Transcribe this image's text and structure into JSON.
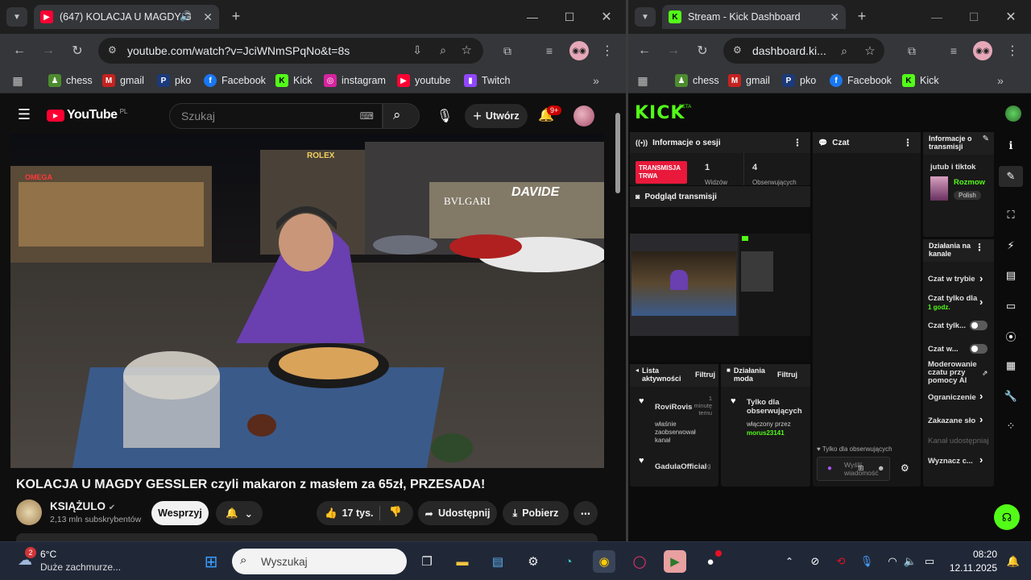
{
  "left_window": {
    "tab_title": "(647) KOLACJA U MAGDY G",
    "url": "youtube.com/watch?v=JciWNmSPqNo&t=8s",
    "bookmarks": [
      "chess",
      "gmail",
      "pko",
      "Facebook",
      "Kick",
      "instagram",
      "youtube",
      "Twitch"
    ]
  },
  "youtube": {
    "logo": "YouTube",
    "country": "PL",
    "search_placeholder": "Szukaj",
    "create_label": "Utwórz",
    "notif_count": "9+",
    "video_title": "KOLACJA U MAGDY GESSLER czyli makaron z masłem za 65zł, PRZESADA!",
    "channel_name": "KSIĄŻULO",
    "subscribers": "2,13 mln subskrybentów",
    "support_label": "Wesprzyj",
    "likes": "17 tys.",
    "share_label": "Udostępnij",
    "download_label": "Pobierz",
    "scene_signs": [
      "ROLEX",
      "BVLGARI",
      "DAVIDE",
      "OMEGA"
    ]
  },
  "right_window": {
    "tab_title": "Stream - Kick Dashboard",
    "url": "dashboard.ki...",
    "bookmarks": [
      "chess",
      "gmail",
      "pko",
      "Facebook",
      "Kick"
    ]
  },
  "kick": {
    "logo": "KICK",
    "beta": "BETA",
    "session_info_title": "Informacje o sesji",
    "live_badge": "TRANSMISJA TRWA",
    "viewers_value": "1",
    "viewers_label": "Widzów",
    "followers_value": "4",
    "followers_label": "Obserwujących",
    "preview_title": "Podgląd transmisji",
    "chat_title": "Czat",
    "stream_info_title": "Informacje o transmisji",
    "stream_name": "jutub i tiktok",
    "category": "Rozmow",
    "language_tag": "Polish",
    "actions_title": "Działania na kanale",
    "actions": [
      {
        "label": "Czat w trybie",
        "sub": ""
      },
      {
        "label": "Czat tylko dla",
        "sub": "1 godz."
      },
      {
        "label": "Czat tylk...",
        "sub": ""
      },
      {
        "label": "Czat w...",
        "sub": ""
      },
      {
        "label": "Moderowanie czatu przy pomocy AI",
        "sub": ""
      },
      {
        "label": "Ograniczenie",
        "sub": ""
      },
      {
        "label": "Zakazane sło",
        "sub": ""
      },
      {
        "label": "Kanał udostępniaj",
        "sub": ""
      },
      {
        "label": "Wyznacz c...",
        "sub": ""
      }
    ],
    "activity_title": "Lista aktywności",
    "filter_label": "Filtruj",
    "activity_items": [
      {
        "user": "RoviRovis",
        "time": "1 minutę temu",
        "text": "właśnie zaobserwował kanał"
      },
      {
        "user": "GadulaOfficial",
        "time": "g",
        "text": ""
      }
    ],
    "mod_title": "Działania moda",
    "mod_item_title": "Tylko dla obserwujących",
    "mod_item_text": "włączony przez",
    "mod_item_user": "morus23141",
    "chat_followers_only": "Tylko dla obserwujących",
    "chat_placeholder": "Wyślij wiadomość"
  },
  "taskbar": {
    "weather_badge": "2",
    "temp": "6°C",
    "weather_text": "Duże zachmurze...",
    "search_placeholder": "Wyszukaj",
    "time": "08:20",
    "date": "12.11.2025"
  },
  "colors": {
    "kick_green": "#53fc18",
    "yt_red": "#ff0033",
    "live_red": "#e8193b"
  }
}
